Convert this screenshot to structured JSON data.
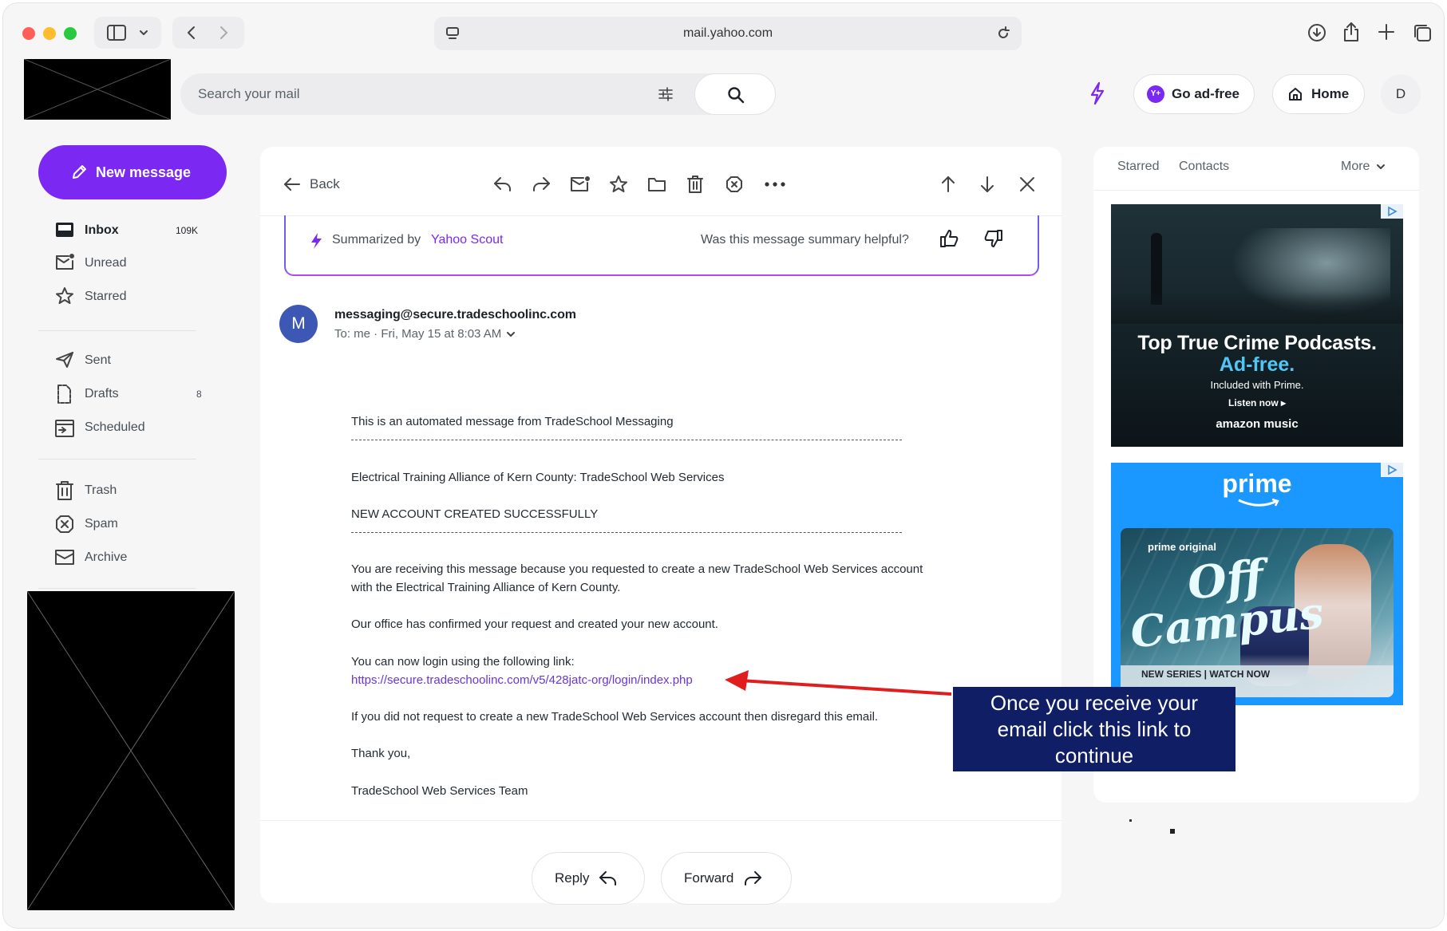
{
  "browser": {
    "url": "mail.yahoo.com"
  },
  "header": {
    "search_placeholder": "Search your mail",
    "go_ad_free": "Go ad-free",
    "home": "Home",
    "avatar_initial": "D"
  },
  "sidebar": {
    "new_message": "New message",
    "items": [
      {
        "label": "Inbox",
        "count": "109K",
        "icon": "inbox-icon"
      },
      {
        "label": "Unread",
        "count": "",
        "icon": "unread-icon"
      },
      {
        "label": "Starred",
        "count": "",
        "icon": "star-icon"
      },
      {
        "label": "Sent",
        "count": "",
        "icon": "send-icon"
      },
      {
        "label": "Drafts",
        "count": "8",
        "icon": "draft-icon"
      },
      {
        "label": "Scheduled",
        "count": "",
        "icon": "calendar-icon"
      },
      {
        "label": "Trash",
        "count": "",
        "icon": "trash-icon"
      },
      {
        "label": "Spam",
        "count": "",
        "icon": "spam-icon"
      },
      {
        "label": "Archive",
        "count": "",
        "icon": "archive-icon"
      }
    ]
  },
  "toolbar": {
    "back": "Back"
  },
  "summary": {
    "prefix": "Summarized by",
    "brand": "Yahoo Scout",
    "question": "Was this message summary helpful?"
  },
  "message": {
    "avatar": "M",
    "sender": "messaging@secure.tradeschoolinc.com",
    "meta": "To: me · Fri, May 15 at 8:03 AM",
    "body": {
      "l1": "This is an automated message from TradeSchool Messaging",
      "l2": "Electrical Training Alliance of Kern County: TradeSchool Web Services",
      "l3": "NEW ACCOUNT CREATED SUCCESSFULLY",
      "l4": "You are receiving this message because you requested to create a new TradeSchool Web Services account",
      "l5": "with the Electrical Training Alliance of Kern County.",
      "l6": "Our office has confirmed your request and created your new account.",
      "l7": "You can now login using the following link:",
      "link": "https://secure.tradeschoolinc.com/v5/428jatc-org/login/index.php",
      "l8": "If you did not request to create a new TradeSchool Web Services account then disregard this email.",
      "l9": "Thank you,",
      "l10": "TradeSchool Web Services Team"
    },
    "reply": "Reply",
    "forward": "Forward"
  },
  "right_panel": {
    "tab_starred": "Starred",
    "tab_contacts": "Contacts",
    "more": "More",
    "ad1": {
      "headline": "Top True Crime Podcasts.",
      "sub": "Ad-free.",
      "small": "Included with Prime.",
      "cta": "Listen now ▸",
      "brand": "amazon music"
    },
    "ad2": {
      "brand": "prime",
      "tag": "prime original",
      "title_line1": "Off",
      "title_line2": "Campus",
      "footer": "NEW SERIES | WATCH NOW"
    }
  },
  "annotation": {
    "text_line1": "Once you receive your",
    "text_line2": "email click this link to",
    "text_line3": "continue",
    "color": "#101e66",
    "arrow_color": "#e01e1e"
  }
}
